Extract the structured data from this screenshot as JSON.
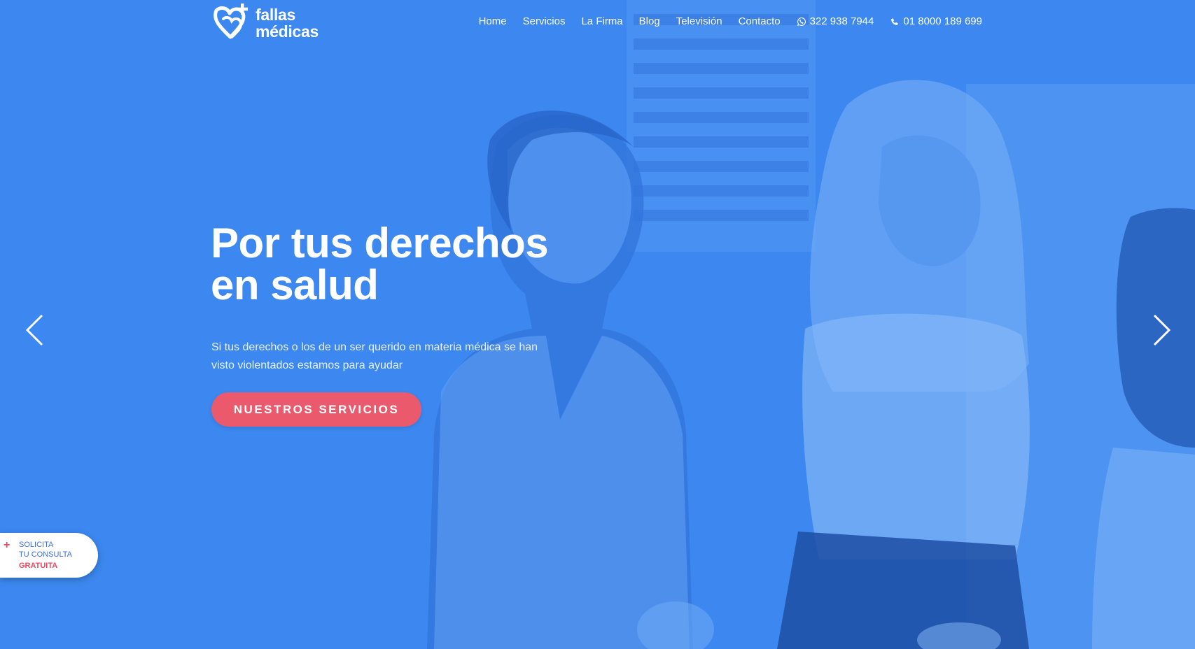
{
  "brand": {
    "line1": "fallas",
    "line2": "médicas"
  },
  "nav": {
    "items": [
      {
        "label": "Home"
      },
      {
        "label": "Servicios"
      },
      {
        "label": "La Firma"
      },
      {
        "label": "Blog"
      },
      {
        "label": "Televisión"
      },
      {
        "label": "Contacto"
      }
    ],
    "whatsapp": "322 938 7944",
    "phone": "01 8000 189 699"
  },
  "hero": {
    "title_line1": "Por tus derechos",
    "title_line2": "en salud",
    "subtitle": "Si tus derechos o los de un ser querido en materia médica se han visto violentados estamos para ayudar",
    "cta": "NUESTROS SERVICIOS"
  },
  "consult_tab": {
    "plus": "+",
    "line1": "SOLICITA",
    "line2": "TU CONSULTA",
    "line3": "GRATUITA"
  },
  "colors": {
    "background": "#3d88f0",
    "accent": "#ea5a6c",
    "text": "#ffffff"
  }
}
